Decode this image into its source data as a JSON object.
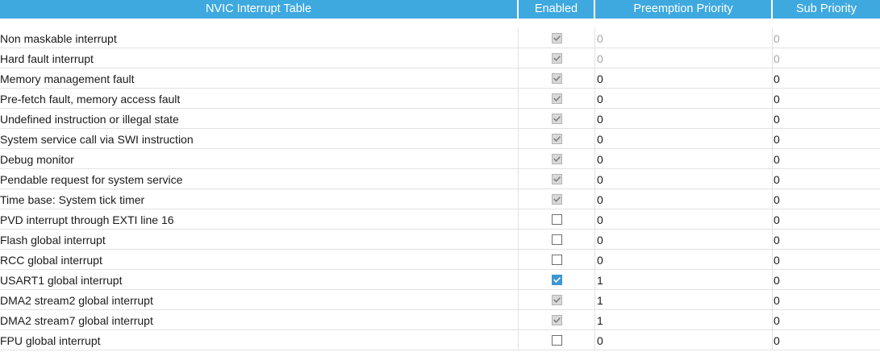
{
  "header": {
    "name_label": "NVIC Interrupt Table",
    "enabled_label": "Enabled",
    "preemption_label": "Preemption Priority",
    "sub_label": "Sub Priority"
  },
  "colors": {
    "header_bg": "#3ea9df",
    "check_active": "#3c96d4",
    "check_disabled": "#d9d9d9"
  },
  "rows": [
    {
      "name": "Non maskable interrupt",
      "enabled": "checked-disabled",
      "preemption": "0",
      "sub": "0",
      "priority_editable": false
    },
    {
      "name": "Hard fault interrupt",
      "enabled": "checked-disabled",
      "preemption": "0",
      "sub": "0",
      "priority_editable": false
    },
    {
      "name": "Memory management fault",
      "enabled": "checked-disabled",
      "preemption": "0",
      "sub": "0",
      "priority_editable": true
    },
    {
      "name": "Pre-fetch fault, memory access fault",
      "enabled": "checked-disabled",
      "preemption": "0",
      "sub": "0",
      "priority_editable": true
    },
    {
      "name": "Undefined instruction or illegal state",
      "enabled": "checked-disabled",
      "preemption": "0",
      "sub": "0",
      "priority_editable": true
    },
    {
      "name": "System service call via SWI instruction",
      "enabled": "checked-disabled",
      "preemption": "0",
      "sub": "0",
      "priority_editable": true
    },
    {
      "name": "Debug monitor",
      "enabled": "checked-disabled",
      "preemption": "0",
      "sub": "0",
      "priority_editable": true
    },
    {
      "name": "Pendable request for system service",
      "enabled": "checked-disabled",
      "preemption": "0",
      "sub": "0",
      "priority_editable": true
    },
    {
      "name": "Time base: System tick timer",
      "enabled": "checked-disabled",
      "preemption": "0",
      "sub": "0",
      "priority_editable": true
    },
    {
      "name": "PVD interrupt through EXTI line 16",
      "enabled": "unchecked",
      "preemption": "0",
      "sub": "0",
      "priority_editable": true
    },
    {
      "name": "Flash global interrupt",
      "enabled": "unchecked",
      "preemption": "0",
      "sub": "0",
      "priority_editable": true
    },
    {
      "name": "RCC global interrupt",
      "enabled": "unchecked",
      "preemption": "0",
      "sub": "0",
      "priority_editable": true
    },
    {
      "name": "USART1 global interrupt",
      "enabled": "checked-active",
      "preemption": "1",
      "sub": "0",
      "priority_editable": true
    },
    {
      "name": "DMA2 stream2 global interrupt",
      "enabled": "checked-disabled",
      "preemption": "1",
      "sub": "0",
      "priority_editable": true
    },
    {
      "name": "DMA2 stream7 global interrupt",
      "enabled": "checked-disabled",
      "preemption": "1",
      "sub": "0",
      "priority_editable": true
    },
    {
      "name": "FPU global interrupt",
      "enabled": "unchecked",
      "preemption": "0",
      "sub": "0",
      "priority_editable": true
    }
  ]
}
